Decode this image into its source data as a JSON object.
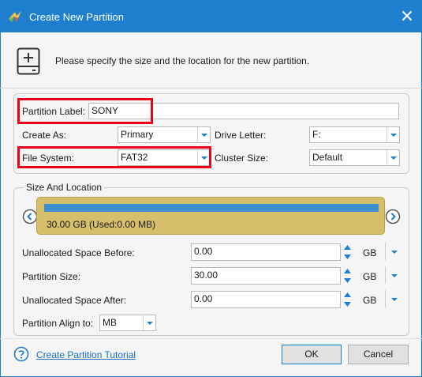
{
  "window": {
    "title": "Create New Partition"
  },
  "header": {
    "instruction": "Please specify the size and the location for the new partition."
  },
  "partition": {
    "label_caption": "Partition Label:",
    "label_value": "SONY",
    "create_as_caption": "Create As:",
    "create_as_value": "Primary",
    "drive_letter_caption": "Drive Letter:",
    "drive_letter_value": "F:",
    "file_system_caption": "File System:",
    "file_system_value": "FAT32",
    "cluster_size_caption": "Cluster Size:",
    "cluster_size_value": "Default"
  },
  "size_location": {
    "group_title": "Size And Location",
    "disk_caption": "30.00 GB (Used:0.00 MB)",
    "used_fraction": 0.0,
    "unallocated_before_caption": "Unallocated Space Before:",
    "unallocated_before_value": "0.00",
    "unallocated_before_unit": "GB",
    "partition_size_caption": "Partition Size:",
    "partition_size_value": "30.00",
    "partition_size_unit": "GB",
    "unallocated_after_caption": "Unallocated Space After:",
    "unallocated_after_value": "0.00",
    "unallocated_after_unit": "GB",
    "align_caption": "Partition Align to:",
    "align_value": "MB"
  },
  "footer": {
    "tutorial_link": "Create Partition Tutorial",
    "ok_label": "OK",
    "cancel_label": "Cancel"
  },
  "colors": {
    "titlebar": "#1e7fcf",
    "highlight": "#e8001c",
    "disk_bar": "#d7be6b",
    "used_bar": "#3d8fd4",
    "link": "#1a6fc6"
  },
  "icons": {
    "app": "app-logo-icon",
    "close": "close-icon",
    "header": "new-partition-icon",
    "help": "help-icon",
    "left": "chevron-left-icon",
    "right": "chevron-right-icon"
  }
}
